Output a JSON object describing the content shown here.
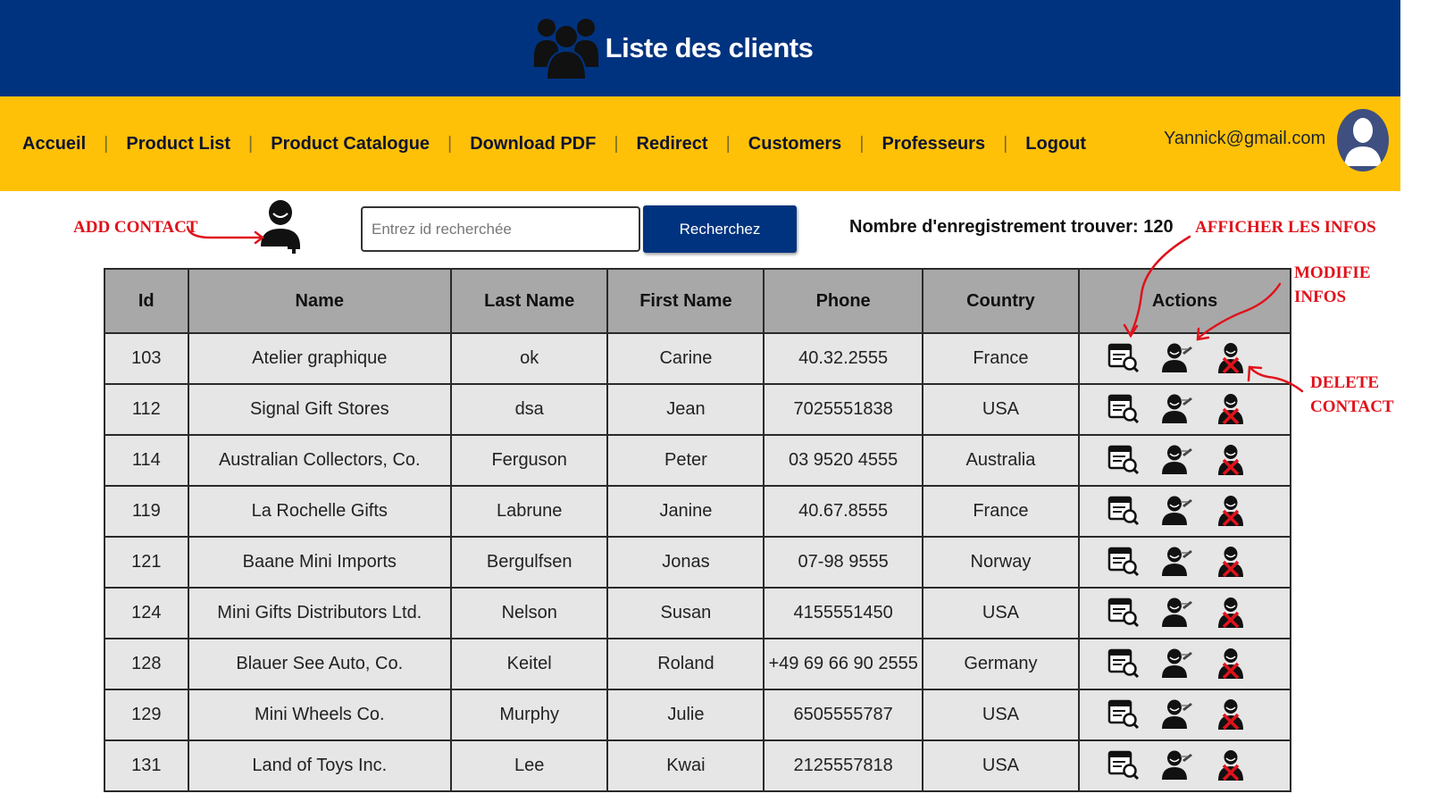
{
  "header": {
    "title": "Liste des clients",
    "icon": "users-group-icon"
  },
  "nav": {
    "items": [
      "Accueil",
      "Product List",
      "Product Catalogue",
      "Download PDF",
      "Redirect",
      "Customers",
      "Professeurs",
      "Logout"
    ],
    "separator": "|",
    "user_email": "Yannick@gmail.com"
  },
  "toolbar": {
    "add_contact_label": "ADD CONTACT",
    "search_placeholder": "Entrez id recherchée",
    "search_value": "",
    "search_button": "Recherchez",
    "record_count_text": "Nombre d'enregistrement trouver: 120"
  },
  "annotations": {
    "afficher": "AFFICHER LES INFOS",
    "modifie_line1": "MODIFIE",
    "modifie_line2": "INFOS",
    "delete_line1": "DELETE",
    "delete_line2": "CONTACT"
  },
  "table": {
    "headers": [
      "Id",
      "Name",
      "Last Name",
      "First Name",
      "Phone",
      "Country",
      "Actions"
    ],
    "rows": [
      [
        "103",
        "Atelier graphique",
        "ok",
        "Carine",
        "40.32.2555",
        "France"
      ],
      [
        "112",
        "Signal Gift Stores",
        "dsa",
        "Jean",
        "7025551838",
        "USA"
      ],
      [
        "114",
        "Australian Collectors, Co.",
        "Ferguson",
        "Peter",
        "03 9520 4555",
        "Australia"
      ],
      [
        "119",
        "La Rochelle Gifts",
        "Labrune",
        "Janine",
        "40.67.8555",
        "France"
      ],
      [
        "121",
        "Baane Mini Imports",
        "Bergulfsen",
        "Jonas",
        "07-98 9555",
        "Norway"
      ],
      [
        "124",
        "Mini Gifts Distributors Ltd.",
        "Nelson",
        "Susan",
        "4155551450",
        "USA"
      ],
      [
        "128",
        "Blauer See Auto, Co.",
        "Keitel",
        "Roland",
        "+49 69 66 90 2555",
        "Germany"
      ],
      [
        "129",
        "Mini Wheels Co.",
        "Murphy",
        "Julie",
        "6505555787",
        "USA"
      ],
      [
        "131",
        "Land of Toys Inc.",
        "Lee",
        "Kwai",
        "2125557818",
        "USA"
      ]
    ]
  },
  "colors": {
    "header_bg": "#00337f",
    "nav_bg": "#ffc107",
    "annotation": "#e0121b",
    "table_header_bg": "#a8a8a8",
    "table_cell_bg": "#e6e6e6"
  }
}
